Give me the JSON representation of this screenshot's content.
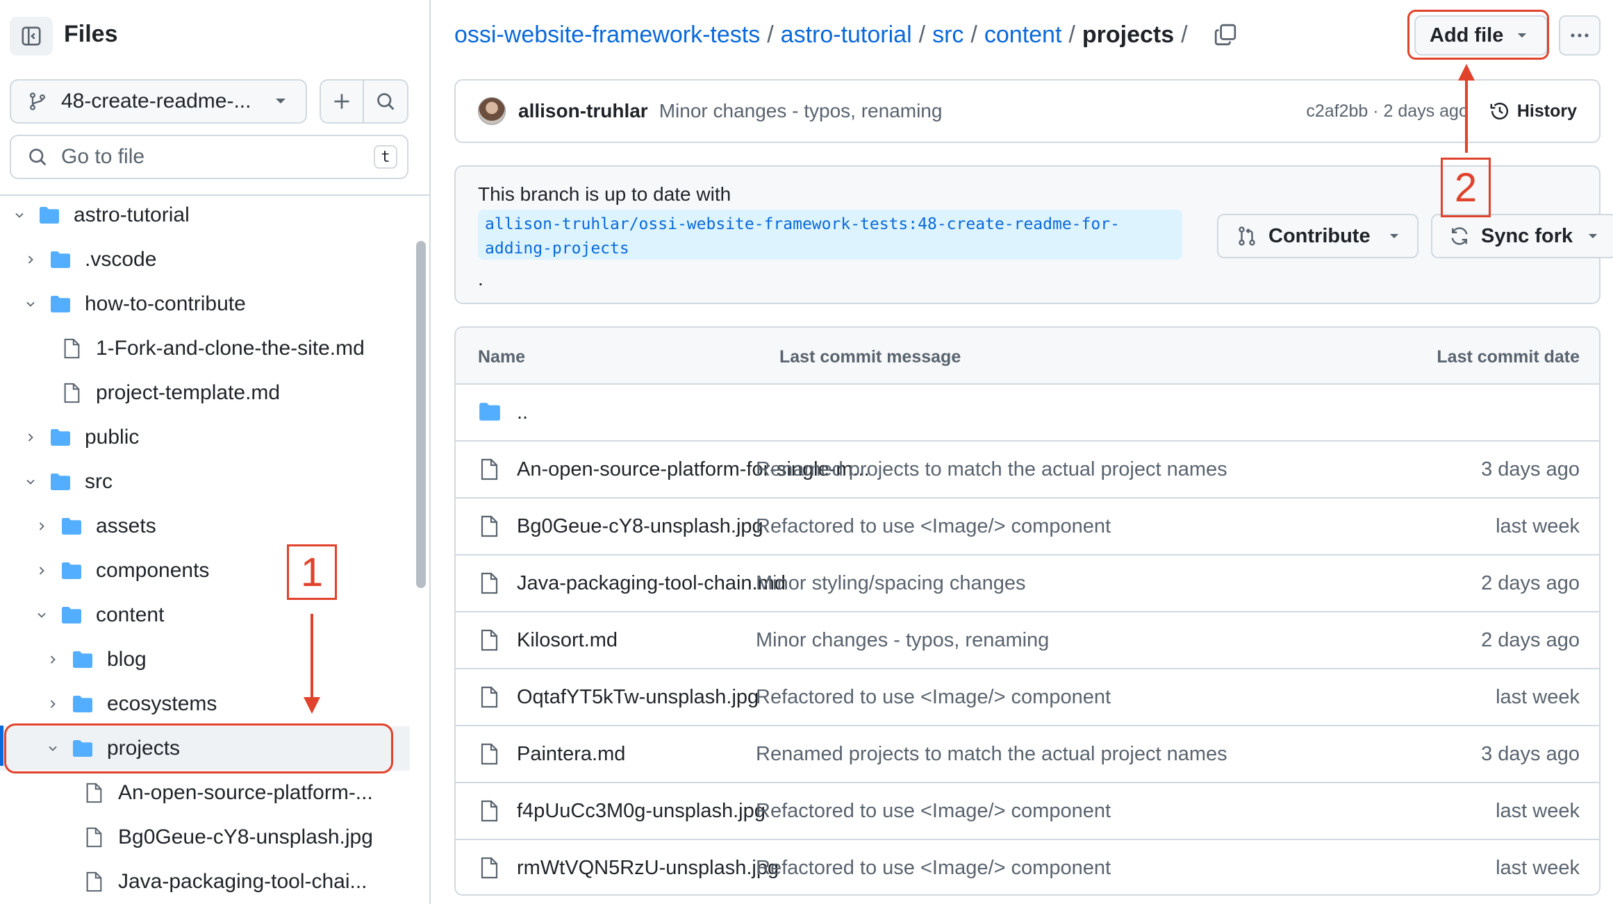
{
  "sidebar": {
    "title": "Files",
    "branch": "48-create-readme-...",
    "goto_placeholder": "Go to file",
    "goto_shortcut": "t",
    "tree": [
      {
        "label": "astro-tutorial",
        "type": "folder",
        "expanded": true,
        "depth": 0
      },
      {
        "label": ".vscode",
        "type": "folder",
        "expanded": false,
        "depth": 1
      },
      {
        "label": "how-to-contribute",
        "type": "folder",
        "expanded": true,
        "depth": 1
      },
      {
        "label": "1-Fork-and-clone-the-site.md",
        "type": "file",
        "depth": 2
      },
      {
        "label": "project-template.md",
        "type": "file",
        "depth": 2
      },
      {
        "label": "public",
        "type": "folder",
        "expanded": false,
        "depth": 1
      },
      {
        "label": "src",
        "type": "folder",
        "expanded": true,
        "depth": 1
      },
      {
        "label": "assets",
        "type": "folder",
        "expanded": false,
        "depth": 2
      },
      {
        "label": "components",
        "type": "folder",
        "expanded": false,
        "depth": 2
      },
      {
        "label": "content",
        "type": "folder",
        "expanded": true,
        "depth": 2
      },
      {
        "label": "blog",
        "type": "folder",
        "expanded": false,
        "depth": 3
      },
      {
        "label": "ecosystems",
        "type": "folder",
        "expanded": false,
        "depth": 3
      },
      {
        "label": "projects",
        "type": "folder",
        "expanded": true,
        "depth": 3,
        "selected": true
      },
      {
        "label": "An-open-source-platform-...",
        "type": "file",
        "depth": 4
      },
      {
        "label": "Bg0Geue-cY8-unsplash.jpg",
        "type": "file",
        "depth": 4
      },
      {
        "label": "Java-packaging-tool-chai...",
        "type": "file",
        "depth": 4
      }
    ]
  },
  "breadcrumb": {
    "items": [
      "ossi-website-framework-tests",
      "astro-tutorial",
      "src",
      "content"
    ],
    "current": "projects",
    "separator": "/"
  },
  "toolbar": {
    "add_file_label": "Add file"
  },
  "commit": {
    "author": "allison-truhlar",
    "message": "Minor changes - typos, renaming",
    "hash_time": "c2af2bb · 2 days ago",
    "history_label": "History"
  },
  "branch_status": {
    "text": "This branch is up to date with",
    "ref": "allison-truhlar/ossi-website-framework-tests:48-create-readme-for-\nadding-projects",
    "dot": ".",
    "contribute_label": "Contribute",
    "sync_fork_label": "Sync fork"
  },
  "table": {
    "headers": {
      "name": "Name",
      "message": "Last commit message",
      "date": "Last commit date"
    },
    "parent": "..",
    "rows": [
      {
        "name": "An-open-source-platform-for-single-m...",
        "message": "Renamed projects to match the actual project names",
        "date": "3 days ago"
      },
      {
        "name": "Bg0Geue-cY8-unsplash.jpg",
        "message": "Refactored to use <Image/> component",
        "date": "last week"
      },
      {
        "name": "Java-packaging-tool-chain.md",
        "message": "Minor styling/spacing changes",
        "date": "2 days ago"
      },
      {
        "name": "Kilosort.md",
        "message": "Minor changes - typos, renaming",
        "date": "2 days ago"
      },
      {
        "name": "OqtafYT5kTw-unsplash.jpg",
        "message": "Refactored to use <Image/> component",
        "date": "last week"
      },
      {
        "name": "Paintera.md",
        "message": "Renamed projects to match the actual project names",
        "date": "3 days ago"
      },
      {
        "name": "f4pUuCc3M0g-unsplash.jpg",
        "message": "Refactored to use <Image/> component",
        "date": "last week"
      },
      {
        "name": "rmWtVQN5RzU-unsplash.jpg",
        "message": "Refactored to use <Image/> component",
        "date": "last week"
      }
    ]
  },
  "annotations": {
    "step1": "1",
    "step2": "2",
    "color": "#e0422b"
  },
  "colors": {
    "link": "#0969da",
    "folder": "#54aeff",
    "border": "#d1d9e0",
    "muted": "#59636e"
  }
}
